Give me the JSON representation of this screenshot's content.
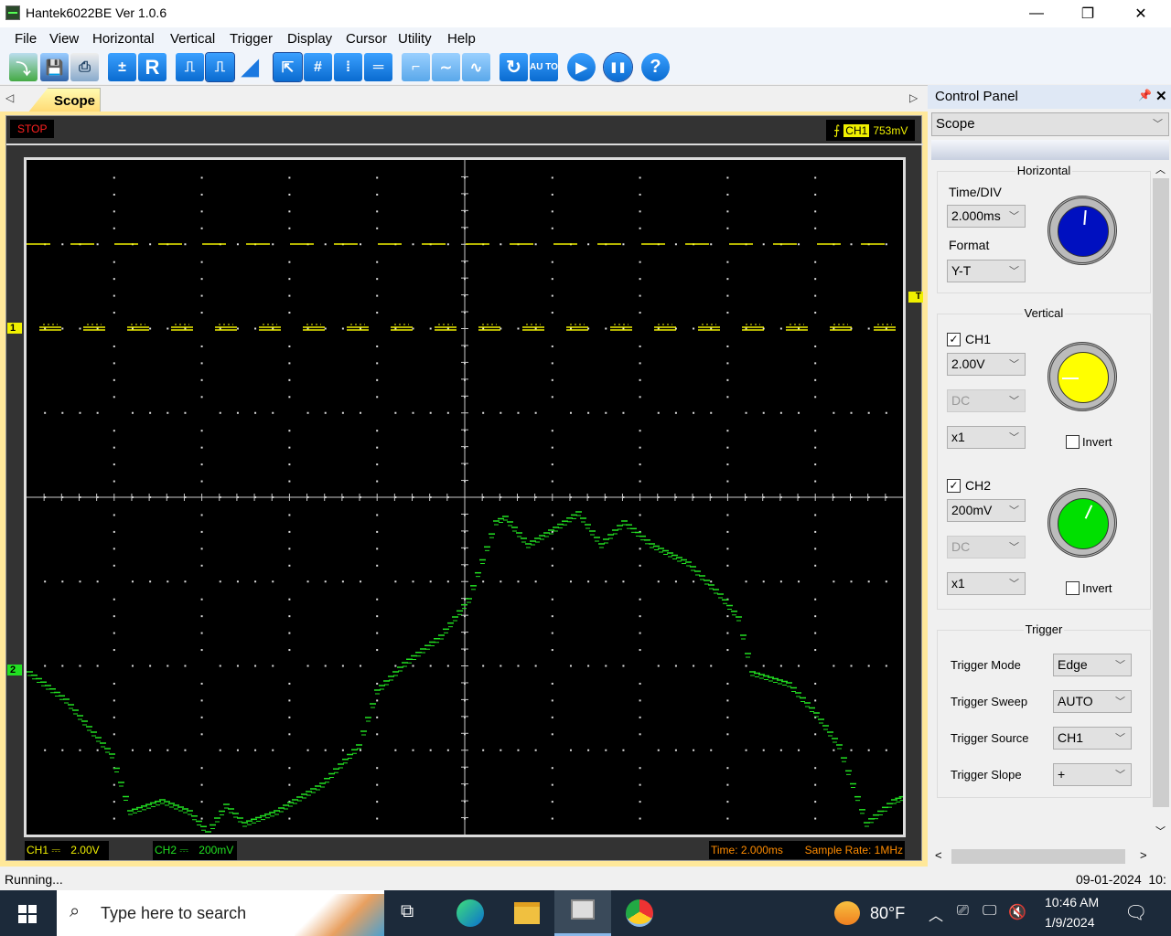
{
  "window": {
    "title": "Hantek6022BE Ver 1.0.6",
    "controls": [
      "—",
      "❐",
      "✕"
    ]
  },
  "menu": [
    "File",
    "View",
    "Horizontal",
    "Vertical",
    "Trigger",
    "Display",
    "Cursor",
    "Utility",
    "Help"
  ],
  "toolbar": [
    {
      "name": "open-icon",
      "glyph": "⤵"
    },
    {
      "name": "save-icon",
      "glyph": "💾"
    },
    {
      "name": "print-icon",
      "glyph": "⎙"
    },
    {
      "name": "math-icon",
      "glyph": "±"
    },
    {
      "name": "reference-icon",
      "glyph": "R"
    },
    {
      "name": "pulse-icon",
      "glyph": "⎍"
    },
    {
      "name": "pulse-dashed-icon",
      "glyph": "⎍"
    },
    {
      "name": "ramp-icon",
      "glyph": "◢"
    },
    {
      "name": "pointer-cursor-icon",
      "glyph": "⇱"
    },
    {
      "name": "cross-cursor-icon",
      "glyph": "#"
    },
    {
      "name": "vertical-cursor-icon",
      "glyph": "⁞"
    },
    {
      "name": "horizontal-cursor-icon",
      "glyph": "═"
    },
    {
      "name": "step-icon",
      "glyph": "⌐"
    },
    {
      "name": "smooth-wave-icon",
      "glyph": "∼"
    },
    {
      "name": "sine-wave-icon",
      "glyph": "∿"
    },
    {
      "name": "refresh-icon",
      "glyph": "↻"
    },
    {
      "name": "auto-icon",
      "glyph": "AU TO"
    },
    {
      "name": "run-icon",
      "glyph": "▶"
    },
    {
      "name": "pause-icon",
      "glyph": "❚❚"
    },
    {
      "name": "help-icon",
      "glyph": "?"
    }
  ],
  "tabs": {
    "active": "Scope"
  },
  "scope": {
    "status": "STOP",
    "trigger_channel": "CH1",
    "trigger_level": "753mV",
    "ch1_marker": "1",
    "ch2_marker": "2",
    "trigger_marker": "T",
    "ch1_readout": {
      "label": "CH1",
      "coupling": "⎓",
      "scale": "2.00V"
    },
    "ch2_readout": {
      "label": "CH2",
      "coupling": "⎓",
      "scale": "200mV"
    },
    "time_readout": "Time: 2.000ms",
    "sample_rate": "Sample Rate: 1MHz",
    "colors": {
      "ch1": "#f0f000",
      "ch2": "#22e022",
      "stop": "#ff2020",
      "info": "#ff8c00"
    }
  },
  "control_panel": {
    "title": "Control Panel",
    "view_select": "Scope",
    "horizontal": {
      "title": "Horizontal",
      "time_div_label": "Time/DIV",
      "time_div": "2.000ms",
      "format_label": "Format",
      "format": "Y-T"
    },
    "vertical": {
      "title": "Vertical",
      "ch1": {
        "label": "CH1",
        "enabled": true,
        "volt_div": "2.00V",
        "coupling": "DC",
        "probe": "x1",
        "invert_label": "Invert",
        "invert": false
      },
      "ch2": {
        "label": "CH2",
        "enabled": true,
        "volt_div": "200mV",
        "coupling": "DC",
        "probe": "x1",
        "invert_label": "Invert",
        "invert": false
      }
    },
    "trigger": {
      "title": "Trigger",
      "rows": [
        {
          "label": "Trigger Mode",
          "value": "Edge"
        },
        {
          "label": "Trigger Sweep",
          "value": "AUTO"
        },
        {
          "label": "Trigger Source",
          "value": "CH1"
        },
        {
          "label": "Trigger Slope",
          "value": "+"
        }
      ]
    }
  },
  "statusbar": {
    "left": "Running...",
    "right": "09-01-2024  10:"
  },
  "taskbar": {
    "search_placeholder": "Type here to search",
    "weather": "80°F",
    "time": "10:46 AM",
    "date": "1/9/2024"
  }
}
